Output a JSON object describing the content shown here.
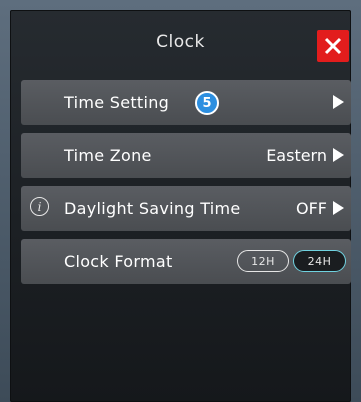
{
  "header": {
    "title": "Clock",
    "close_icon": "close-icon"
  },
  "rows": [
    {
      "label": "Time Setting",
      "badge": "5",
      "arrow_icon": "chevron-right-icon"
    },
    {
      "label": "Time Zone",
      "value": "Eastern",
      "arrow_icon": "chevron-right-icon"
    },
    {
      "label": "Daylight Saving Time",
      "value": "OFF",
      "info_icon": "i",
      "arrow_icon": "chevron-right-icon"
    },
    {
      "label": "Clock Format",
      "options": [
        "12H",
        "24H"
      ],
      "selected": "24H"
    }
  ],
  "colors": {
    "close_button": "#e21d1d",
    "badge": "#2d8fe0",
    "selected_toggle_border": "#6fd2e0"
  }
}
